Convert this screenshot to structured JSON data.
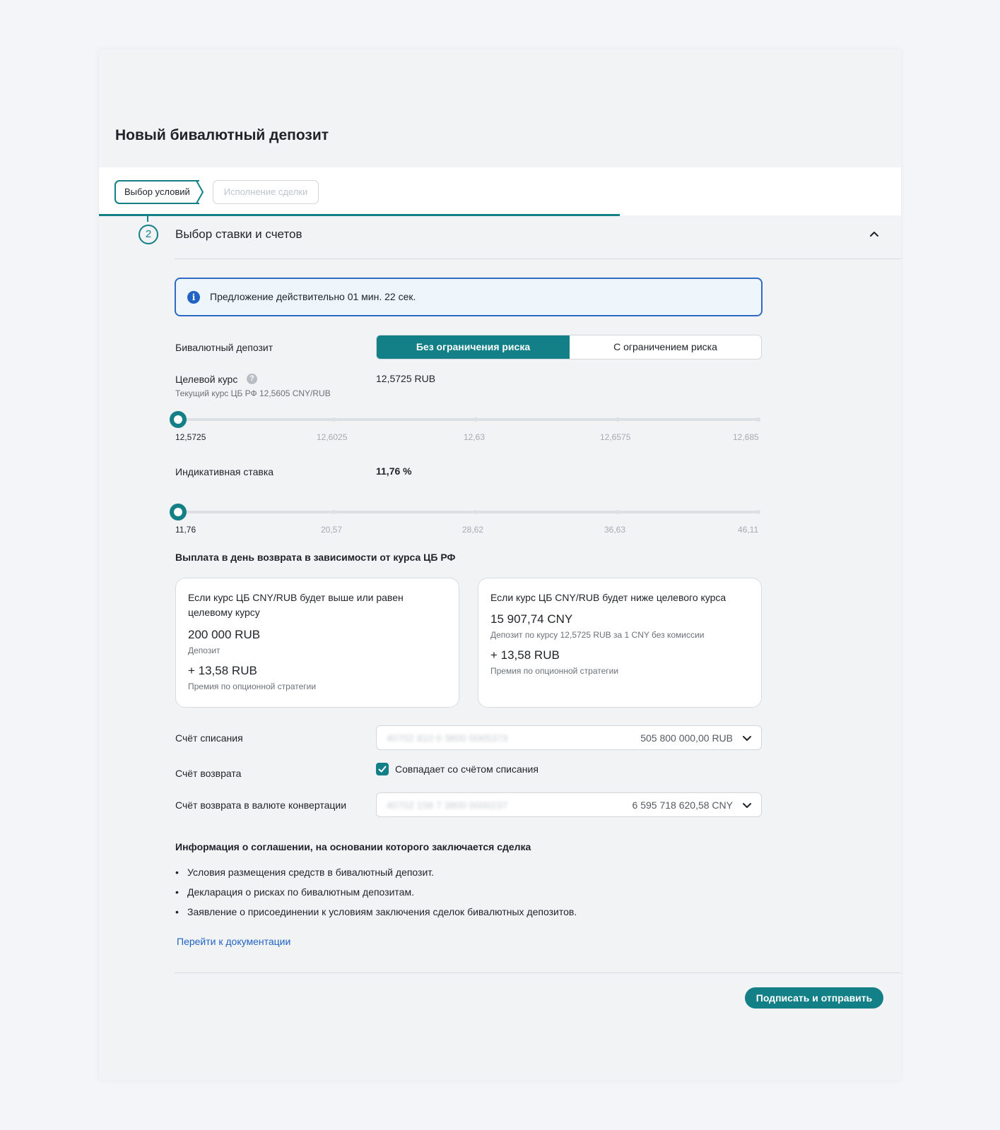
{
  "page": {
    "title": "Новый бивалютный депозит"
  },
  "steps": [
    {
      "label": "Выбор условий",
      "state": "active"
    },
    {
      "label": "Исполнение сделки",
      "state": "inactive"
    }
  ],
  "section": {
    "number": "2",
    "title": "Выбор ставки и счетов",
    "expanded": true
  },
  "notice": {
    "icon": "info-icon",
    "text": "Предложение действительно 01 мин. 22 сек."
  },
  "deposit_type": {
    "label": "Бивалютный депозит",
    "options": [
      "Без ограничения риска",
      "С ограничением риска"
    ],
    "selected": "Без ограничения риска"
  },
  "target_rate": {
    "label": "Целевой курс",
    "help_icon": "help-icon",
    "help_glyph": "?",
    "sublabel": "Текущий курс ЦБ РФ 12,5605 CNY/RUB",
    "value": "12,5725 RUB",
    "ticks": [
      "12,5725",
      "12,6025",
      "12,63",
      "12,6575",
      "12,685"
    ],
    "slider_position": 0
  },
  "indicative_rate": {
    "label": "Индикативная ставка",
    "value": "11,76 %",
    "ticks": [
      "11,76",
      "20,57",
      "28,62",
      "36,63",
      "46,11"
    ],
    "slider_position": 0
  },
  "payout": {
    "title": "Выплата в день возврата в зависимости от курса ЦБ РФ",
    "above": {
      "condition": "Если курс ЦБ CNY/RUB будет выше или равен целевому курсу",
      "amount": "200 000 RUB",
      "amount_note": "Депозит",
      "premium": "+ 13,58 RUB",
      "premium_note": "Премия по опционной стратегии"
    },
    "below": {
      "condition": "Если курс ЦБ CNY/RUB будет ниже целевого курса",
      "amount": "15 907,74 CNY",
      "amount_note": "Депозит по курсу 12,5725 RUB за 1 CNY без комиссии",
      "premium": "+ 13,58 RUB",
      "premium_note": "Премия по опционной стратегии"
    }
  },
  "accounts": {
    "debit": {
      "label": "Счёт списания",
      "account": "40702 810 0 3800 0065373",
      "balance": "505 800 000,00 RUB"
    },
    "return": {
      "label": "Счёт возврата",
      "checkbox_label": "Совпадает со счётом списания",
      "checked": true
    },
    "conversion": {
      "label": "Счёт возврата в валюте конвертации",
      "account": "40702 156 7 3800 0000237",
      "balance": "6 595 718 620,58 CNY"
    }
  },
  "agreement": {
    "title": "Информация о соглашении, на основании которого заключается сделка",
    "items": [
      "Условия размещения средств в бивалютный депозит.",
      "Декларация о рисках по бивалютным депозитам.",
      "Заявление о присоединении к условиям заключения сделок бивалютных депозитов."
    ],
    "link": "Перейти к документации"
  },
  "submit_label": "Подписать и отправить",
  "colors": {
    "accent": "#137f86",
    "link": "#2063c2",
    "notice_border": "#2e6cc4",
    "notice_bg": "#eef5fb"
  }
}
